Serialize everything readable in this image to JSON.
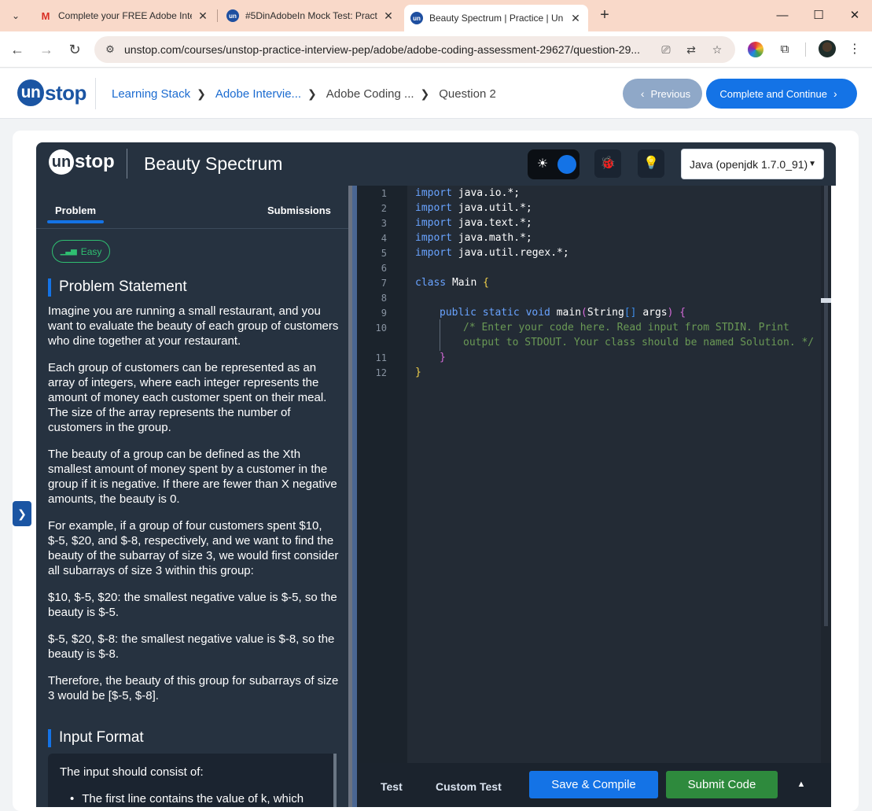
{
  "browser": {
    "tabs": [
      {
        "title": "Complete your FREE Adobe Inte",
        "favicon": "gmail-icon"
      },
      {
        "title": "#5DinAdobeIn Mock Test: Pract",
        "favicon": "unstop-icon"
      },
      {
        "title": "Beauty Spectrum | Practice | Un",
        "favicon": "unstop-icon"
      }
    ],
    "favicon_unstop_text": "un",
    "favicon_gmail_text": "M",
    "url": "unstop.com/courses/unstop-practice-interview-pep/adobe/adobe-coding-assessment-29627/question-29..."
  },
  "header": {
    "logo_un": "un",
    "logo_rest": "stop",
    "breadcrumbs": [
      "Learning Stack",
      "Adobe Intervie...",
      "Adobe Coding ...",
      "Question 2"
    ],
    "previous_label": "Previous",
    "next_label": "Complete and Continue"
  },
  "ide": {
    "logo_un": "un",
    "logo_rest": "stop",
    "title": "Beauty Spectrum",
    "language": "Java (openjdk 1.7.0_91)"
  },
  "problem": {
    "tabs": [
      "Problem",
      "Submissions"
    ],
    "difficulty": "Easy",
    "statement_heading": "Problem Statement",
    "paragraphs": [
      "Imagine you are running a small restaurant, and you want to evaluate the beauty of each group of customers who dine together at your restaurant.",
      "Each group of customers can be represented as an array of integers, where each integer represents the amount of money each customer spent on their meal. The size of the array represents the number of customers in the group.",
      "The beauty of a group can be defined as the Xth smallest amount of money spent by a customer in the group if it is negative. If there are fewer than X negative amounts, the beauty is 0.",
      "For example, if a group of four customers spent $10, $-5, $20, and $-8, respectively, and we want to find the beauty of the subarray of size 3, we would first consider all subarrays of size 3 within this group:",
      "$10, $-5, $20: the smallest negative value is $-5, so the beauty is $-5.",
      "$-5, $20, $-8: the smallest negative value is $-8, so the beauty is $-8.",
      "Therefore, the beauty of this group for subarrays of size 3 would be [$-5, $-8]."
    ],
    "input_heading": "Input Format",
    "input_intro": "The input should consist of:",
    "input_bullet": "The first line contains the value of k, which"
  },
  "editor": {
    "line_numbers": [
      "1",
      "2",
      "3",
      "4",
      "5",
      "6",
      "7",
      "8",
      "9",
      "10",
      "11",
      "12"
    ],
    "import_kw": "import",
    "imports": [
      "java.io.*;",
      "java.util.*;",
      "java.text.*;",
      "java.math.*;",
      "java.util.regex.*;"
    ],
    "class_kw": "class",
    "class_name": "Main",
    "method_kws": "public static void",
    "method_name": "main",
    "param_type": "String",
    "param_name": "args",
    "comment_line1": "/* Enter your code here. Read input from STDIN. Print",
    "comment_line2": "output to STDOUT. Your class should be named Solution. */"
  },
  "footer": {
    "test_label": "Test",
    "custom_test_label": "Custom Test",
    "compile_label": "Save & Compile",
    "submit_label": "Submit Code"
  }
}
